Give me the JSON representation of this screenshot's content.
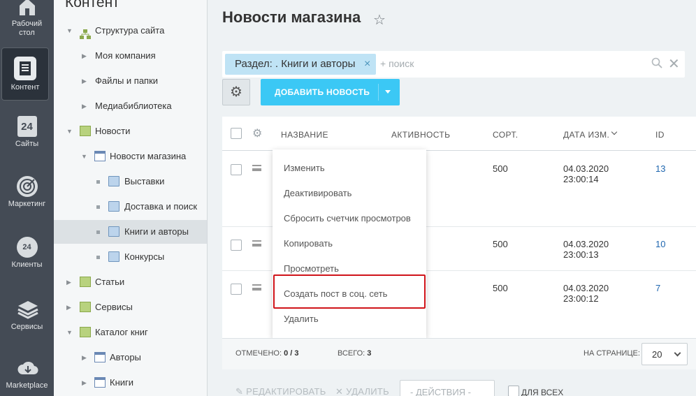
{
  "iconbar": {
    "items": [
      {
        "label_line1": "Рабочий",
        "label_line2": "стол",
        "icon": "home-icon"
      },
      {
        "label_line1": "Контент",
        "label_line2": "",
        "icon": "document-icon"
      },
      {
        "label_line1": "Сайты",
        "label_line2": "",
        "icon": "calendar-24-icon"
      },
      {
        "label_line1": "Маркетинг",
        "label_line2": "",
        "icon": "target-icon"
      },
      {
        "label_line1": "Клиенты",
        "label_line2": "",
        "icon": "cloud-24-icon"
      },
      {
        "label_line1": "Сервисы",
        "label_line2": "",
        "icon": "layers-icon"
      },
      {
        "label_line1": "Marketplace",
        "label_line2": "",
        "icon": "cloud-download-icon"
      }
    ]
  },
  "tree": {
    "title": "Контент",
    "nodes": [
      {
        "label": "Структура сайта"
      },
      {
        "label": "Моя компания"
      },
      {
        "label": "Файлы и папки"
      },
      {
        "label": "Медиабиблиотека"
      },
      {
        "label": "Новости"
      },
      {
        "label": "Новости магазина"
      },
      {
        "label": "Выставки"
      },
      {
        "label": "Доставка и поиск"
      },
      {
        "label": "Книги и авторы"
      },
      {
        "label": "Конкурсы"
      },
      {
        "label": "Статьи"
      },
      {
        "label": "Сервисы"
      },
      {
        "label": "Каталог книг"
      },
      {
        "label": "Авторы"
      },
      {
        "label": "Книги"
      }
    ]
  },
  "page": {
    "title": "Новости магазина"
  },
  "filter": {
    "chip": "Раздел: . Книги и авторы",
    "chip_close": "×",
    "search_placeholder": "+ поиск",
    "clear": "✕"
  },
  "toolbar": {
    "gear": "⚙",
    "add_label": "ДОБАВИТЬ НОВОСТЬ"
  },
  "grid": {
    "columns": {
      "name": "НАЗВАНИЕ",
      "active": "АКТИВНОСТЬ",
      "sort": "СОРТ.",
      "date": "ДАТА ИЗМ.",
      "id": "ID"
    },
    "rows": [
      {
        "sort": "500",
        "date": "04.03.2020",
        "time": "23:00:14",
        "id": "13"
      },
      {
        "sort": "500",
        "date": "04.03.2020",
        "time": "23:00:13",
        "id": "10"
      },
      {
        "sort": "500",
        "date": "04.03.2020",
        "time": "23:00:12",
        "id": "7"
      }
    ]
  },
  "context_menu": {
    "items": [
      "Изменить",
      "Деактивировать",
      "Сбросить счетчик просмотров",
      "Копировать",
      "Просмотреть",
      "Создать пост в соц. сеть",
      "Удалить"
    ]
  },
  "footer": {
    "selected_label": "ОТМЕЧЕНО:",
    "selected_value": "0 / 3",
    "total_label": "ВСЕГО:",
    "total_value": "3",
    "perpage_label": "НА СТРАНИЦЕ:",
    "perpage_value": "20"
  },
  "actions": {
    "edit": "РЕДАКТИРОВАТЬ",
    "delete": "УДАЛИТЬ",
    "select": "- ДЕЙСТВИЯ -",
    "for_all": "ДЛЯ ВСЕХ"
  }
}
